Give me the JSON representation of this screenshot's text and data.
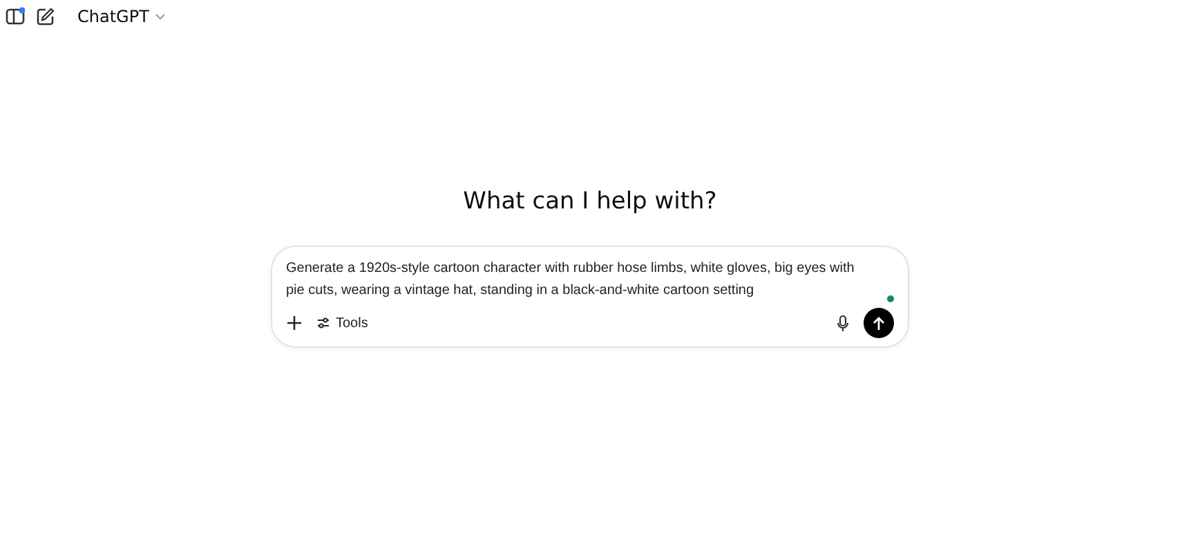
{
  "header": {
    "title": "ChatGPT"
  },
  "heading": "What can I help with?",
  "composer": {
    "value": "Generate a 1920s-style cartoon character with rubber hose limbs, white gloves, big eyes with pie cuts, wearing a vintage hat, standing in a black-and-white cartoon setting",
    "tools_label": "Tools"
  }
}
